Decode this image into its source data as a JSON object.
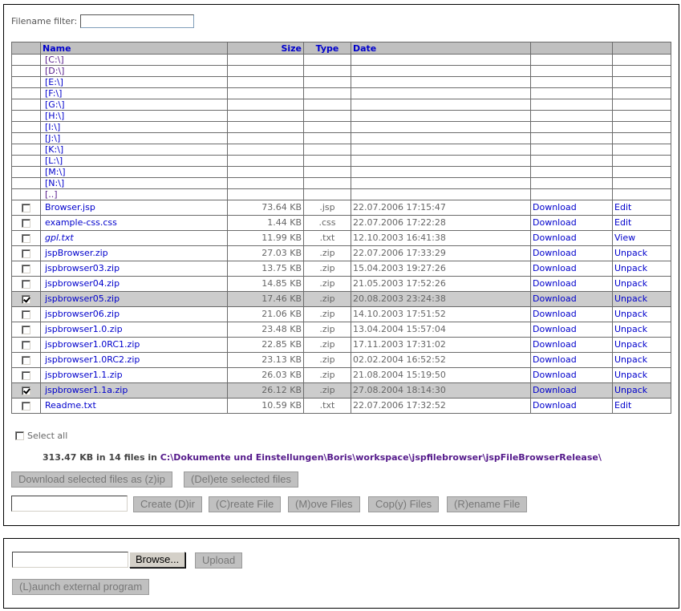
{
  "filter": {
    "label": "Filename filter:",
    "value": ""
  },
  "table": {
    "headers": {
      "name": "Name",
      "size": "Size",
      "type": "Type",
      "date": "Date"
    },
    "drives": [
      {
        "label": "[C:\\]",
        "visited": true
      },
      {
        "label": "[D:\\]",
        "visited": true
      },
      {
        "label": "[E:\\]",
        "visited": false
      },
      {
        "label": "[F:\\]",
        "visited": false
      },
      {
        "label": "[G:\\]",
        "visited": false
      },
      {
        "label": "[H:\\]",
        "visited": false
      },
      {
        "label": "[I:\\]",
        "visited": false
      },
      {
        "label": "[J:\\]",
        "visited": false
      },
      {
        "label": "[K:\\]",
        "visited": false
      },
      {
        "label": "[L:\\]",
        "visited": false
      },
      {
        "label": "[M:\\]",
        "visited": false
      },
      {
        "label": "[N:\\]",
        "visited": false
      },
      {
        "label": "[..]",
        "visited": true
      }
    ],
    "files": [
      {
        "name": "Browser.jsp",
        "size": "73.64 KB",
        "type": ".jsp",
        "date": "22.07.2006 17:15:47",
        "download": "Download",
        "action": "Edit",
        "checked": false,
        "italic": false
      },
      {
        "name": "example-css.css",
        "size": "1.44 KB",
        "type": ".css",
        "date": "22.07.2006 17:22:28",
        "download": "Download",
        "action": "Edit",
        "checked": false,
        "italic": false
      },
      {
        "name": "gpl.txt",
        "size": "11.99 KB",
        "type": ".txt",
        "date": "12.10.2003 16:41:38",
        "download": "Download",
        "action": "View",
        "checked": false,
        "italic": true
      },
      {
        "name": "jspBrowser.zip",
        "size": "27.03 KB",
        "type": ".zip",
        "date": "22.07.2006 17:33:29",
        "download": "Download",
        "action": "Unpack",
        "checked": false,
        "italic": false
      },
      {
        "name": "jspbrowser03.zip",
        "size": "13.75 KB",
        "type": ".zip",
        "date": "15.04.2003 19:27:26",
        "download": "Download",
        "action": "Unpack",
        "checked": false,
        "italic": false
      },
      {
        "name": "jspbrowser04.zip",
        "size": "14.85 KB",
        "type": ".zip",
        "date": "21.05.2003 17:52:26",
        "download": "Download",
        "action": "Unpack",
        "checked": false,
        "italic": false
      },
      {
        "name": "jspbrowser05.zip",
        "size": "17.46 KB",
        "type": ".zip",
        "date": "20.08.2003 23:24:38",
        "download": "Download",
        "action": "Unpack",
        "checked": true,
        "italic": false
      },
      {
        "name": "jspbrowser06.zip",
        "size": "21.06 KB",
        "type": ".zip",
        "date": "14.10.2003 17:51:52",
        "download": "Download",
        "action": "Unpack",
        "checked": false,
        "italic": false
      },
      {
        "name": "jspbrowser1.0.zip",
        "size": "23.48 KB",
        "type": ".zip",
        "date": "13.04.2004 15:57:04",
        "download": "Download",
        "action": "Unpack",
        "checked": false,
        "italic": false
      },
      {
        "name": "jspbrowser1.0RC1.zip",
        "size": "22.85 KB",
        "type": ".zip",
        "date": "17.11.2003 17:31:02",
        "download": "Download",
        "action": "Unpack",
        "checked": false,
        "italic": false
      },
      {
        "name": "jspbrowser1.0RC2.zip",
        "size": "23.13 KB",
        "type": ".zip",
        "date": "02.02.2004 16:52:52",
        "download": "Download",
        "action": "Unpack",
        "checked": false,
        "italic": false
      },
      {
        "name": "jspbrowser1.1.zip",
        "size": "26.03 KB",
        "type": ".zip",
        "date": "21.08.2004 15:19:50",
        "download": "Download",
        "action": "Unpack",
        "checked": false,
        "italic": false
      },
      {
        "name": "jspbrowser1.1a.zip",
        "size": "26.12 KB",
        "type": ".zip",
        "date": "27.08.2004 18:14:30",
        "download": "Download",
        "action": "Unpack",
        "checked": true,
        "italic": false
      },
      {
        "name": "Readme.txt",
        "size": "10.59 KB",
        "type": ".txt",
        "date": "22.07.2006 17:32:52",
        "download": "Download",
        "action": "Edit",
        "checked": false,
        "italic": false
      }
    ]
  },
  "select_all": {
    "label": "Select all",
    "checked": false
  },
  "summary": {
    "text": "313.47 KB in 14 files in ",
    "path": "C:\\Dokumente und Einstellungen\\Boris\\workspace\\jspfilebrowser\\jspFileBrowserRelease\\"
  },
  "buttons": {
    "download_zip": "Download selected files as (z)ip",
    "delete": "(Del)ete selected files",
    "create_dir": "Create (D)ir",
    "create_file": "(C)reate File",
    "move": "(M)ove Files",
    "copy": "Cop(y) Files",
    "rename": "(R)ename File",
    "browse": "Browse...",
    "upload": "Upload",
    "launch": "(L)aunch external program"
  },
  "inputs": {
    "name_value": "",
    "upload_path": ""
  },
  "colors": {
    "header_bg": "#c0c0c0",
    "link": "#0000cc",
    "visited": "#551a8b",
    "selected_row": "#cccccc"
  }
}
